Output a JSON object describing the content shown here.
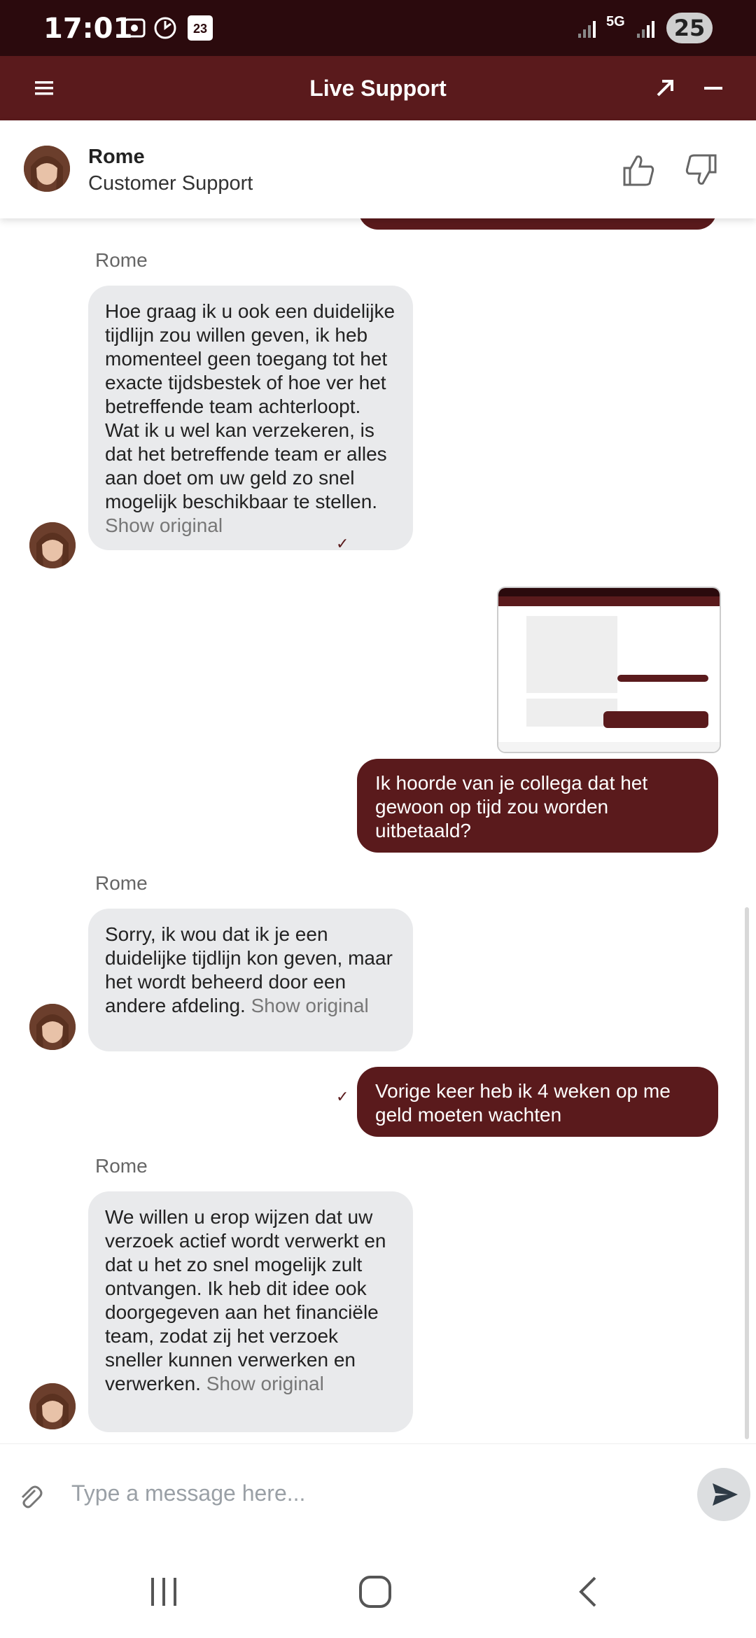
{
  "status_bar": {
    "time": "17:01",
    "calendar_day": "23",
    "network": "5G",
    "battery": "25"
  },
  "app_bar": {
    "title": "Live Support"
  },
  "agent": {
    "name": "Rome",
    "role": "Customer Support"
  },
  "messages": [
    {
      "sender": "Rome",
      "text": "Hoe graag ik u ook een duidelijke tijdlijn zou willen geven, ik heb momenteel geen toegang tot het exacte tijdsbestek of hoe ver het betreffende team achterloopt. Wat ik u wel kan verzekeren, is dat het betreffende team er alles aan doet om uw geld zo snel mogelijk beschikbaar te stellen.",
      "show_original": "Show original"
    },
    {
      "sender": "me",
      "text": "Ik hoorde van je collega dat het gewoon op tijd zou worden uitbetaald?"
    },
    {
      "sender": "Rome",
      "text": "Sorry, ik wou dat ik je een duidelijke tijdlijn kon geven, maar het wordt beheerd door een andere afdeling.",
      "show_original": "Show original"
    },
    {
      "sender": "me",
      "text": "Vorige keer heb ik 4 weken op me geld moeten wachten"
    },
    {
      "sender": "Rome",
      "text": "We willen u erop wijzen dat uw verzoek actief wordt verwerkt en dat u het zo snel mogelijk zult ontvangen. Ik heb dit idee ook doorgegeven aan het financiële team, zodat zij het verzoek sneller kunnen verwerken en verwerken.",
      "show_original": "Show original"
    }
  ],
  "composer": {
    "placeholder": "Type a message here..."
  },
  "colors": {
    "brand": "#5a1a1c",
    "status_bar": "#2b0a0d",
    "incoming_bubble": "#e9eaec"
  }
}
